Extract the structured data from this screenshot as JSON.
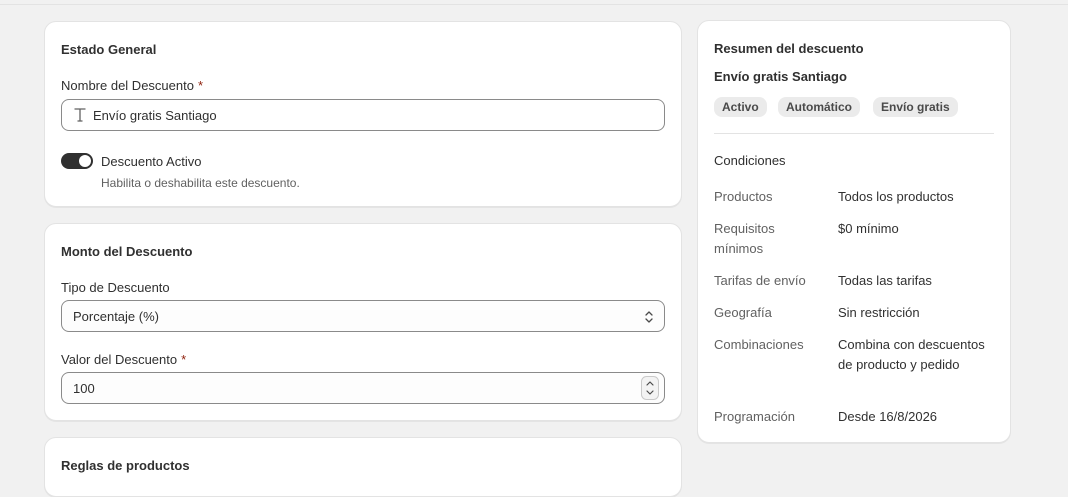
{
  "estado": {
    "title": "Estado General",
    "name_label": "Nombre del Descuento",
    "required_mark": "*",
    "name_value": "Envío gratis Santiago",
    "toggle_label": "Descuento Activo",
    "toggle_help": "Habilita o deshabilita este descuento.",
    "toggle_on": true
  },
  "monto": {
    "title": "Monto del Descuento",
    "type_label": "Tipo de Descuento",
    "type_value": "Porcentaje (%)",
    "value_label": "Valor del Descuento",
    "required_mark": "*",
    "value_value": "100"
  },
  "reglas": {
    "title": "Reglas de productos"
  },
  "resumen": {
    "title": "Resumen del descuento",
    "discount_name": "Envío gratis Santiago",
    "badges": [
      "Activo",
      "Automático",
      "Envío gratis"
    ],
    "conditions_title": "Condiciones",
    "rows": [
      {
        "key": "Productos",
        "value": "Todos los productos"
      },
      {
        "key": "Requisitos mínimos",
        "value": "$0 mínimo"
      },
      {
        "key": "Tarifas de envío",
        "value": "Todas las tarifas"
      },
      {
        "key": "Geografía",
        "value": "Sin restricción"
      },
      {
        "key": "Combinaciones",
        "value": "Combina con descuentos de producto y pedido"
      },
      {
        "key": "Programación",
        "value": "Desde 16/8/2026"
      }
    ]
  },
  "colors": {
    "background": "#f1f1f1",
    "card": "#ffffff",
    "text": "#303030",
    "muted": "#616161",
    "required": "#8e1f0b",
    "toggle_on": "#303030",
    "badge_bg": "#ebebeb"
  },
  "icons": {
    "text_field": "text-type-icon",
    "select": "select-chevrons-icon",
    "stepper": "number-stepper-icon"
  }
}
